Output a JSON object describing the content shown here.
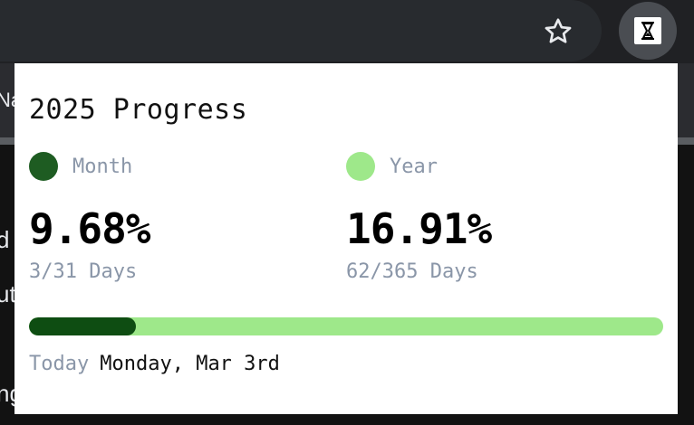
{
  "background_page": {
    "fragments": [
      "Na",
      "d",
      "ut",
      "ng"
    ]
  },
  "toolbar": {
    "bookmark_icon": "star-icon",
    "extension_icon": "hourglass-icon"
  },
  "popup": {
    "title": "2025 Progress",
    "month": {
      "label": "Month",
      "percent": "9.68%",
      "days": "3/31 Days",
      "color": "#1e5c22"
    },
    "year": {
      "label": "Year",
      "percent": "16.91%",
      "days": "62/365 Days",
      "color": "#9ee88a"
    },
    "progress_bar": {
      "fill_fraction": 0.1691,
      "fill_color": "#0e4d12",
      "track_color": "#9ee88a"
    },
    "today": {
      "label": "Today",
      "date": "Monday, Mar 3rd"
    }
  }
}
